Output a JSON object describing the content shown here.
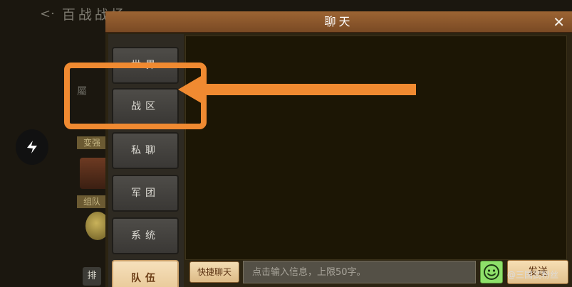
{
  "background": {
    "title": "百战战场",
    "back_icon": "back-arrow-icon",
    "side_text": "屬",
    "tag_top": "变强",
    "tag_bottom": "组队",
    "rank_button": "排",
    "top_right_text": ""
  },
  "share": {
    "icon": "share-icon"
  },
  "dialog": {
    "title": "聊天",
    "close_icon": "✕"
  },
  "tabs": [
    {
      "label": "世界",
      "active": false
    },
    {
      "label": "战区",
      "active": false
    },
    {
      "label": "私聊",
      "active": false
    },
    {
      "label": "军团",
      "active": false
    },
    {
      "label": "系统",
      "active": false
    },
    {
      "label": "队伍",
      "active": true
    }
  ],
  "footer": {
    "quick_chat_label": "快捷聊天",
    "input_placeholder": "点击输入信息，上限50字。",
    "input_value": "",
    "emoji_icon": "smiley-icon",
    "send_label": "发送"
  },
  "annotation": {
    "highlight_color": "#f08a31",
    "arrow_target": "战区"
  },
  "watermark": "@三国武粉丝",
  "colors": {
    "header": "#8a5a2c",
    "active_tab": "#f2d7aa",
    "chat_bg": "#1c1605",
    "emoji": "#8ee06a"
  }
}
